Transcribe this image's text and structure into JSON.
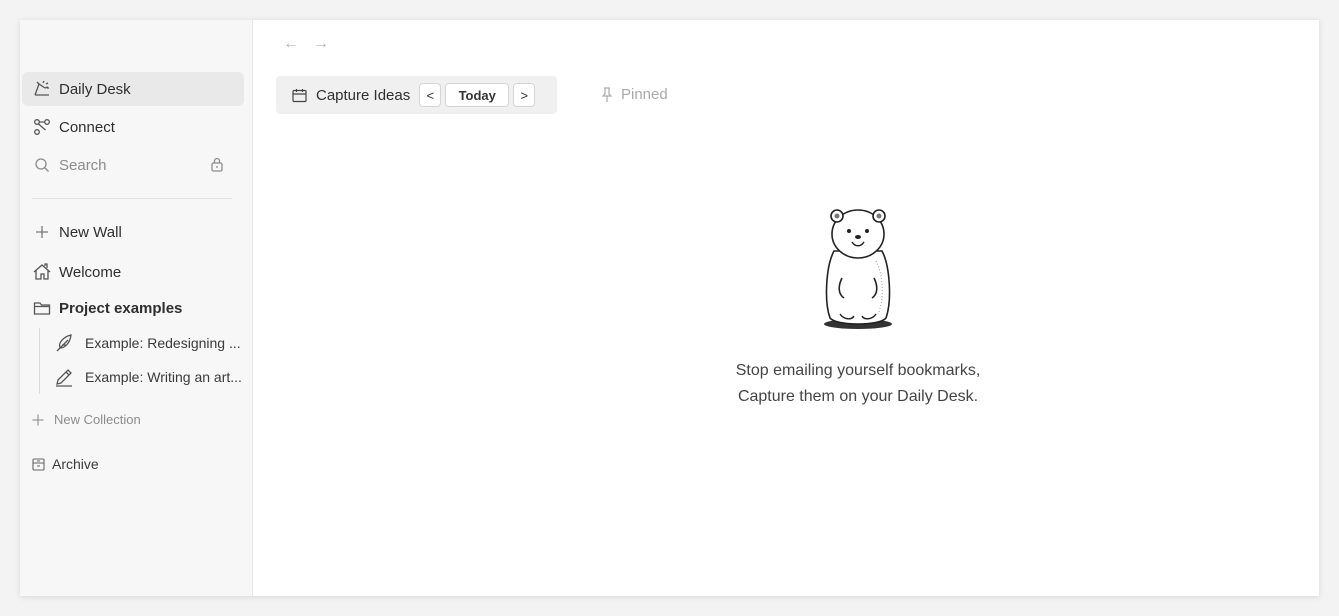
{
  "sidebar": {
    "daily_desk": "Daily Desk",
    "connect": "Connect",
    "search_placeholder": "Search",
    "new_wall": "New Wall",
    "welcome": "Welcome",
    "project_examples": "Project examples",
    "children": [
      {
        "label": "Example: Redesigning ..."
      },
      {
        "label": "Example: Writing an art..."
      }
    ],
    "new_collection": "New Collection",
    "archive": "Archive"
  },
  "toolbar": {
    "title": "Capture Ideas",
    "today": "Today",
    "prev": "<",
    "next": ">",
    "pinned": "Pinned"
  },
  "nav": {
    "back": "←",
    "forward": "→"
  },
  "empty_state": {
    "line1": "Stop emailing yourself bookmarks,",
    "line2": "Capture them on your Daily Desk."
  }
}
